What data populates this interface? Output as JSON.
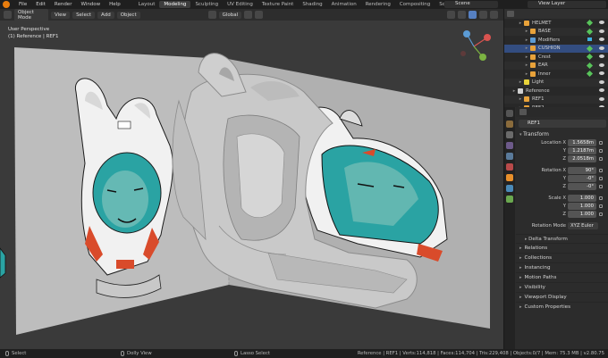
{
  "topbar": {
    "menus": [
      "File",
      "Edit",
      "Render",
      "Window",
      "Help"
    ],
    "workspaces": [
      "Layout",
      "Modeling",
      "Sculpting",
      "UV Editing",
      "Texture Paint",
      "Shading",
      "Animation",
      "Rendering",
      "Compositing",
      "Scripting"
    ],
    "active_workspace": "Modeling",
    "scene": "Scene",
    "view_layer": "View Layer"
  },
  "viewport": {
    "mode": "Object Mode",
    "menus": [
      "View",
      "Select",
      "Add",
      "Object"
    ],
    "transform_orientation": "Global",
    "info_line1": "User Perspective",
    "info_line2": "(1) Reference | REF1"
  },
  "outliner": {
    "rows": [
      {
        "label": "HELMET",
        "indent": 2,
        "icon": "mesh-icon",
        "selected": false
      },
      {
        "label": "BASE",
        "indent": 3,
        "icon": "mesh-icon",
        "selected": false
      },
      {
        "label": "Modifiers",
        "indent": 3,
        "icon": "wrench-icon",
        "selected": false
      },
      {
        "label": "CUSHION",
        "indent": 3,
        "icon": "mesh-icon",
        "selected": true
      },
      {
        "label": "Crest",
        "indent": 3,
        "icon": "mesh-icon",
        "selected": false
      },
      {
        "label": "EAR",
        "indent": 3,
        "icon": "mesh-icon",
        "selected": false
      },
      {
        "label": "Inner",
        "indent": 3,
        "icon": "mesh-icon",
        "selected": false
      },
      {
        "label": "Light",
        "indent": 2,
        "icon": "light-icon",
        "selected": false
      },
      {
        "label": "Reference",
        "indent": 1,
        "icon": "collection-icon",
        "selected": false
      },
      {
        "label": "REF1",
        "indent": 2,
        "icon": "image-icon",
        "selected": false
      },
      {
        "label": "REF2",
        "indent": 2,
        "icon": "image-icon",
        "selected": false
      }
    ]
  },
  "properties": {
    "object_name": "REF1",
    "transform_title": "Transform",
    "location": {
      "label": "Location X",
      "x": "1.5658m",
      "y": "1.2187m",
      "z": "2.0518m"
    },
    "rotation": {
      "label": "Rotation X",
      "x": "90°",
      "y": "-0°",
      "z": "-0°"
    },
    "scale": {
      "label": "Scale X",
      "x": "1.000",
      "y": "1.000",
      "z": "1.000"
    },
    "axis_y": "Y",
    "axis_z": "Z",
    "rotation_mode_label": "Rotation Mode",
    "rotation_mode": "XYZ Euler",
    "delta_transform": "Delta Transform",
    "sections": [
      "Relations",
      "Collections",
      "Instancing",
      "Motion Paths",
      "Visibility",
      "Viewport Display",
      "Custom Properties"
    ]
  },
  "statusbar": {
    "select": "Select",
    "dolly": "Dolly View",
    "lasso": "Lasso Select",
    "stats": "Reference | REF1 | Verts:114,818 | Faces:114,704 | Tris:229,408 | Objects:0/7 | Mem: 75.3 MB | v2.80.75"
  },
  "colors": {
    "accent_orange": "#e87d0d",
    "selection_blue": "#334d80",
    "helmet_teal": "#2aa3a3",
    "helmet_red": "#d94b2b"
  }
}
